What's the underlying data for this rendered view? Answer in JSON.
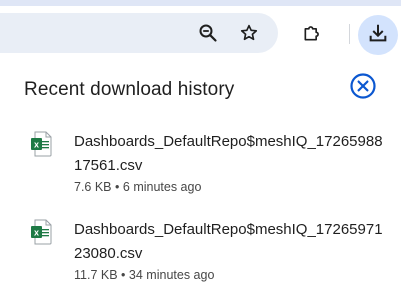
{
  "toolbar": {
    "zoom_icon": "zoom-out-icon",
    "bookmark_icon": "star-outline-icon",
    "extensions_icon": "puzzle-piece-icon",
    "downloads_icon": "download-arrow-icon"
  },
  "panel": {
    "title": "Recent download history",
    "close_icon": "close-circle-icon"
  },
  "downloads": [
    {
      "file_name": "Dashboards_DefaultRepo$meshIQ_1726598817561.csv",
      "size": "7.6 KB",
      "separator": "•",
      "time": "6 minutes ago",
      "icon": "excel-file-icon"
    },
    {
      "file_name": "Dashboards_DefaultRepo$meshIQ_1726597123080.csv",
      "size": "11.7 KB",
      "separator": "•",
      "time": "34 minutes ago",
      "icon": "excel-file-icon"
    }
  ],
  "colors": {
    "accent": "#0b57d0",
    "download_button_bg": "#d3e3fd",
    "omnibox_bg": "#e9eef6",
    "excel_green": "#1e7a45"
  }
}
